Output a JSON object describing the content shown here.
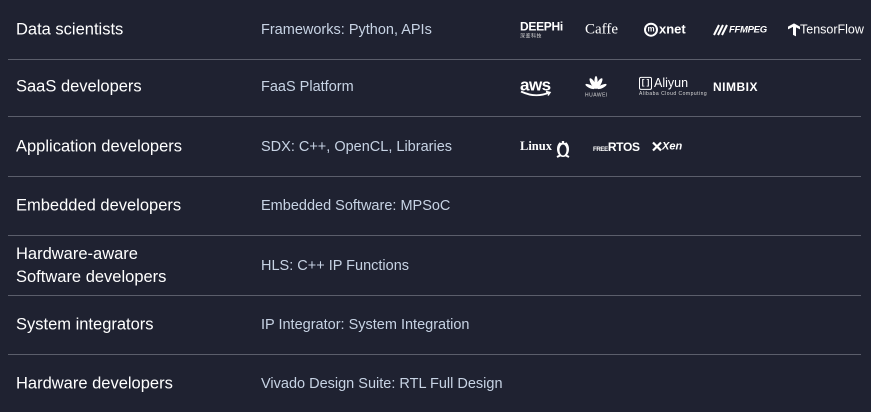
{
  "rows": [
    {
      "audience": "Data scientists",
      "tooling": "Frameworks: Python, APIs"
    },
    {
      "audience": "SaaS developers",
      "tooling": "FaaS Platform"
    },
    {
      "audience": "Application developers",
      "tooling": "SDX: C++, OpenCL, Libraries"
    },
    {
      "audience": "Embedded developers",
      "tooling": "Embedded Software: MPSoC"
    },
    {
      "audience": "Hardware-aware\nSoftware developers",
      "tooling": "HLS: C++ IP Functions"
    },
    {
      "audience": "System integrators",
      "tooling": "IP Integrator: System Integration"
    },
    {
      "audience": "Hardware developers",
      "tooling": "Vivado Design Suite: RTL Full Design"
    }
  ],
  "logos": {
    "deephi": {
      "name": "DEEPHi",
      "sub": "深鉴科技"
    },
    "caffe": {
      "name": "Caffe"
    },
    "mxnet": {
      "name": "xnet",
      "mark": "m"
    },
    "ffmpeg": {
      "name": "FFMPEG"
    },
    "tensorflow": {
      "name": "TensorFlow"
    },
    "aws": {
      "name": "aws"
    },
    "huawei": {
      "name": "HUAWEI"
    },
    "aliyun": {
      "name": "Aliyun",
      "sub": "Alibaba Cloud Computing"
    },
    "nimbix": {
      "name": "NIMBIX"
    },
    "linux": {
      "name": "Linux"
    },
    "rtos": {
      "name": "RTOS",
      "prefix": "FREE"
    },
    "xen": {
      "name": "Xen"
    }
  },
  "colors": {
    "background": "#1f2231",
    "divider": "#5b5e6b",
    "audience_text": "#ffffff",
    "tooling_text": "#c7d3e4"
  }
}
